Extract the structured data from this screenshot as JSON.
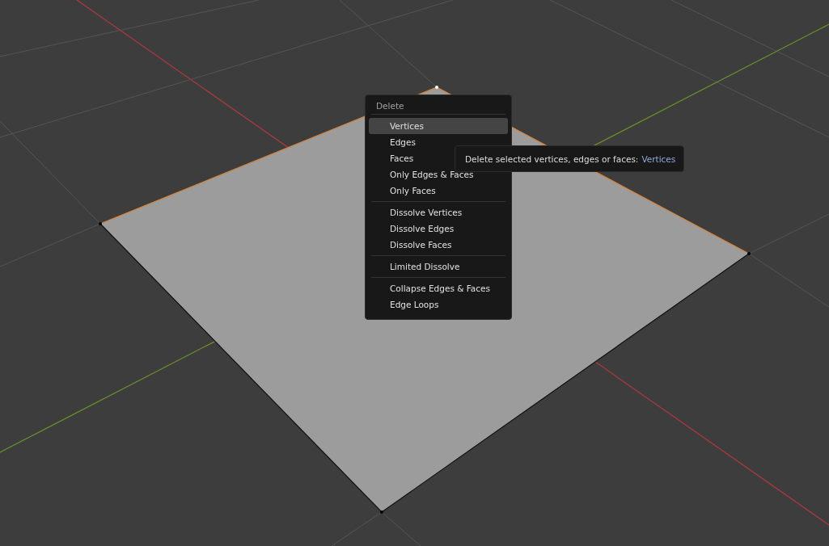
{
  "menu": {
    "title": "Delete",
    "groups": [
      [
        {
          "label": "Vertices",
          "selected": true
        },
        {
          "label": "Edges",
          "selected": false
        },
        {
          "label": "Faces",
          "selected": false
        },
        {
          "label": "Only Edges & Faces",
          "selected": false
        },
        {
          "label": "Only Faces",
          "selected": false
        }
      ],
      [
        {
          "label": "Dissolve Vertices",
          "selected": false
        },
        {
          "label": "Dissolve Edges",
          "selected": false
        },
        {
          "label": "Dissolve Faces",
          "selected": false
        }
      ],
      [
        {
          "label": "Limited Dissolve",
          "selected": false
        }
      ],
      [
        {
          "label": "Collapse Edges & Faces",
          "selected": false
        },
        {
          "label": "Edge Loops",
          "selected": false
        }
      ]
    ]
  },
  "tooltip": {
    "text": "Delete selected vertices, edges or faces:",
    "value": "Vertices"
  }
}
